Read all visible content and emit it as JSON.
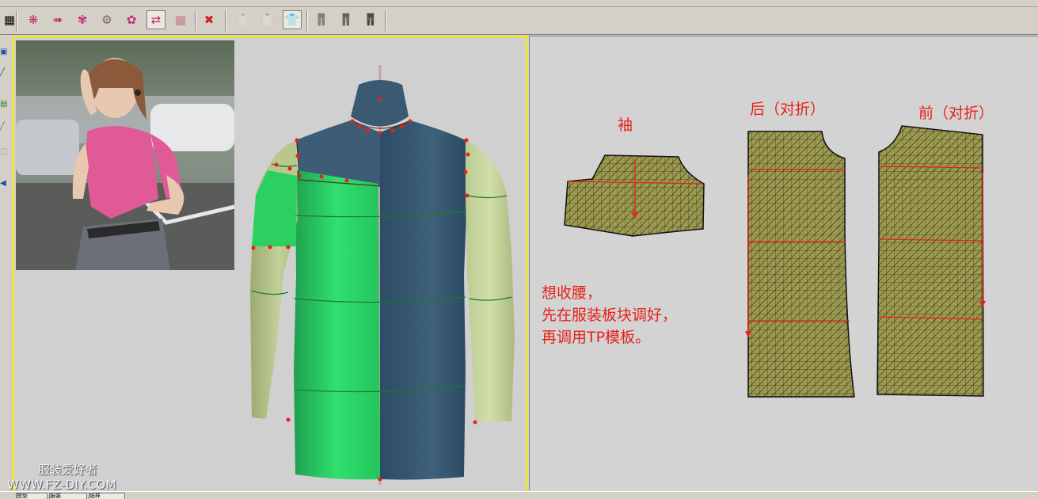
{
  "toolbar": {
    "buttons": [
      {
        "name": "snapshot-icon",
        "glyph": "▦"
      },
      {
        "name": "pattern-layout-icon",
        "glyph": "❋"
      },
      {
        "name": "pattern-export-icon",
        "glyph": "➠"
      },
      {
        "name": "pattern-sew-icon",
        "glyph": "✾"
      },
      {
        "name": "pattern-find-icon",
        "glyph": "⚙"
      },
      {
        "name": "pattern-merge-icon",
        "glyph": "✿"
      },
      {
        "name": "pattern-arrange-icon",
        "glyph": "⇄"
      },
      {
        "name": "pattern-grid-icon",
        "glyph": "▩"
      },
      {
        "name": "pattern-delete-icon",
        "glyph": "✖"
      },
      {
        "name": "shirt-outline-icon",
        "glyph": "👕"
      },
      {
        "name": "shirt-gray-icon",
        "glyph": "👕"
      },
      {
        "name": "shirt-blue-icon",
        "glyph": "👕"
      },
      {
        "name": "pants-outline-icon",
        "glyph": "👖"
      },
      {
        "name": "pants-gray-icon",
        "glyph": "👖"
      },
      {
        "name": "pants-dark-icon",
        "glyph": "👖"
      }
    ],
    "colors": {
      "shirt_blue": "#1e6fd0"
    }
  },
  "view3d": {
    "watermark_cn": "服装爱好者",
    "watermark_url": "WWW.FZ-DIY.COM",
    "colors": {
      "front_green": "#27c45c",
      "back_blue": "#3a5a72",
      "sleeve_green": "#b9c78f",
      "seam_red": "#e8201a"
    }
  },
  "view2d": {
    "label_sleeve": "袖",
    "label_back": "后（对折）",
    "label_front": "前（对折）",
    "note_lines": [
      "想收腰，",
      "先在服装板块调好，",
      "再调用TP模板。"
    ],
    "colors": {
      "pattern_fill": "#9c9a52",
      "mesh_line": "#3c3c10",
      "guide_red": "#e8201a"
    }
  },
  "statusbar": {
    "tabs": [
      "模型",
      "服装",
      "纸样"
    ]
  }
}
